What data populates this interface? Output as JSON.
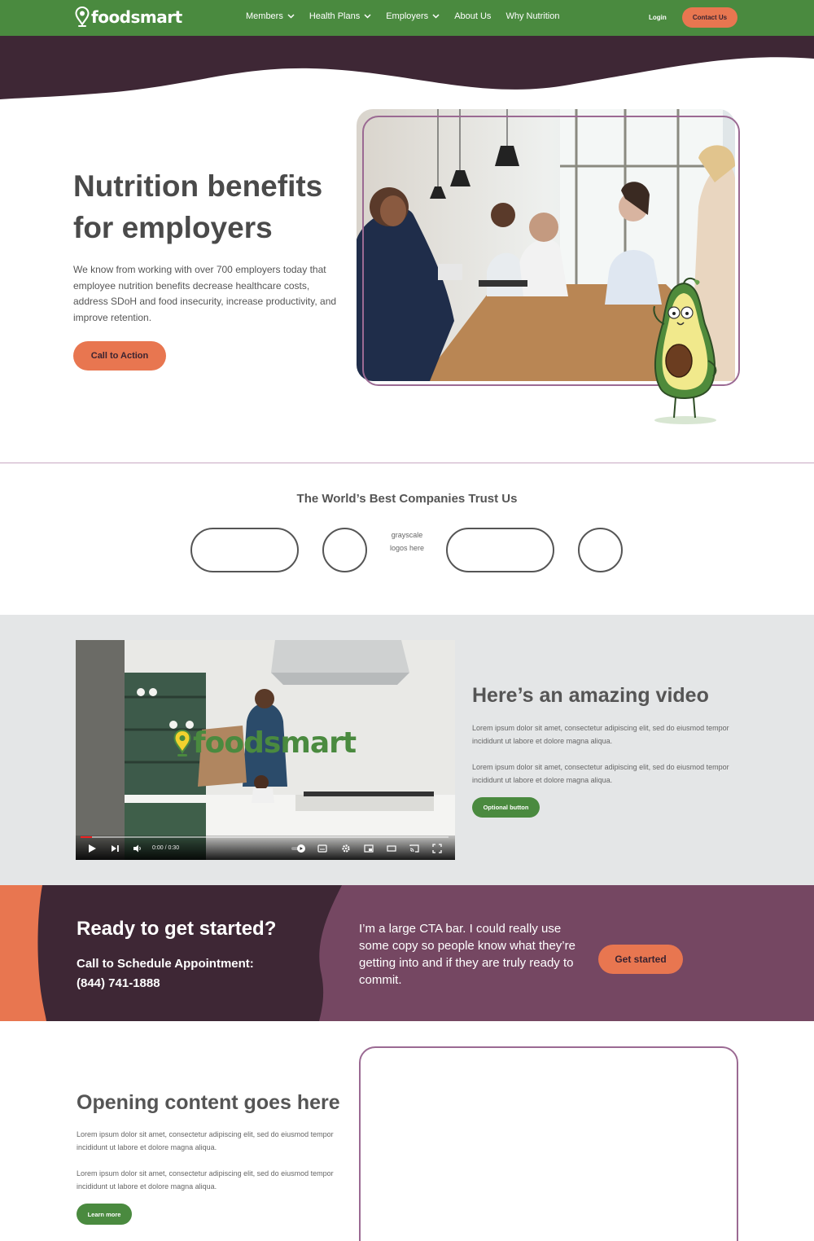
{
  "nav": {
    "logo_text": "foodsmart",
    "links": [
      {
        "label": "Members",
        "has_dropdown": true
      },
      {
        "label": "Health Plans",
        "has_dropdown": true
      },
      {
        "label": "Employers",
        "has_dropdown": true
      },
      {
        "label": "About Us",
        "has_dropdown": false
      },
      {
        "label": "Why Nutrition",
        "has_dropdown": false
      }
    ],
    "login": "Login",
    "contact": "Contact Us"
  },
  "hero": {
    "title": "Nutrition benefits for employers",
    "body": "We know from working with over 700 employers today that employee nutrition benefits decrease healthcare costs, address SDoH and food insecurity, increase productivity, and improve retention.",
    "cta": "Call to Action"
  },
  "trust": {
    "title": "The World’s Best Companies Trust Us",
    "note": "grayscale logos here"
  },
  "video_section": {
    "video_logo_text": "foodsmart",
    "time": "0:00 / 0:30",
    "progress": 0.03,
    "title": "Here’s an amazing video",
    "para1": "Lorem ipsum dolor sit amet, consectetur adipiscing elit, sed do eiusmod tempor incididunt ut labore et dolore magna aliqua.",
    "para2": "Lorem ipsum dolor sit amet, consectetur adipiscing elit, sed do eiusmod tempor incididunt ut labore et dolore magna aliqua.",
    "button": "Optional button"
  },
  "cta_bar": {
    "title": "Ready to get started?",
    "subtitle_line1": "Call to Schedule Appointment:",
    "phone": "(844) 741-1888",
    "copy": "I’m a large CTA bar. I could really use some copy so people know what they’re getting into and if they are truly ready to commit.",
    "button": "Get started"
  },
  "opening": {
    "title": "Opening content goes here",
    "para1": "Lorem ipsum dolor sit amet, consectetur adipiscing elit, sed do eiusmod tempor incididunt ut labore et dolore magna aliqua.",
    "para2": "Lorem ipsum dolor sit amet, consectetur adipiscing elit, sed do eiusmod tempor incididunt ut labore et dolore magna aliqua.",
    "button": "Learn more"
  },
  "colors": {
    "brand_green": "#4a8a3f",
    "plum_dark": "#3e2735",
    "plum_light": "#754762",
    "accent_orange": "#e87650",
    "outline_purple": "#9b6a93",
    "gray_section": "#e4e6e7"
  }
}
